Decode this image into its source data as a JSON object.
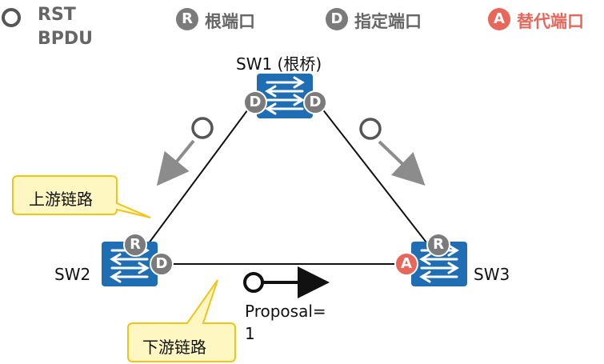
{
  "legend": {
    "bpdu_line1": "RST",
    "bpdu_line2": "BPDU",
    "root_port": {
      "letter": "R",
      "label": "根端口",
      "color": "#7b7b7b"
    },
    "designated_port": {
      "letter": "D",
      "label": "指定端口",
      "color": "#7b7b7b"
    },
    "alternate_port": {
      "letter": "A",
      "label": "替代端口",
      "color": "#e8665a"
    }
  },
  "switches": {
    "sw1": {
      "label": "SW1 (根桥)"
    },
    "sw2": {
      "label": "SW2"
    },
    "sw3": {
      "label": "SW3"
    }
  },
  "callouts": {
    "upstream": "上游链路",
    "downstream": "下游链路"
  },
  "proposal": {
    "line1": "Proposal=",
    "line2": "1"
  },
  "colors": {
    "switch_blue": "#1f6db3",
    "port_gray": "#7b7b7b",
    "alternate_red": "#e8665a",
    "callout_fill": "#fff7c2",
    "callout_border": "#f0c419",
    "arrow_gray": "#8c8c8c"
  }
}
